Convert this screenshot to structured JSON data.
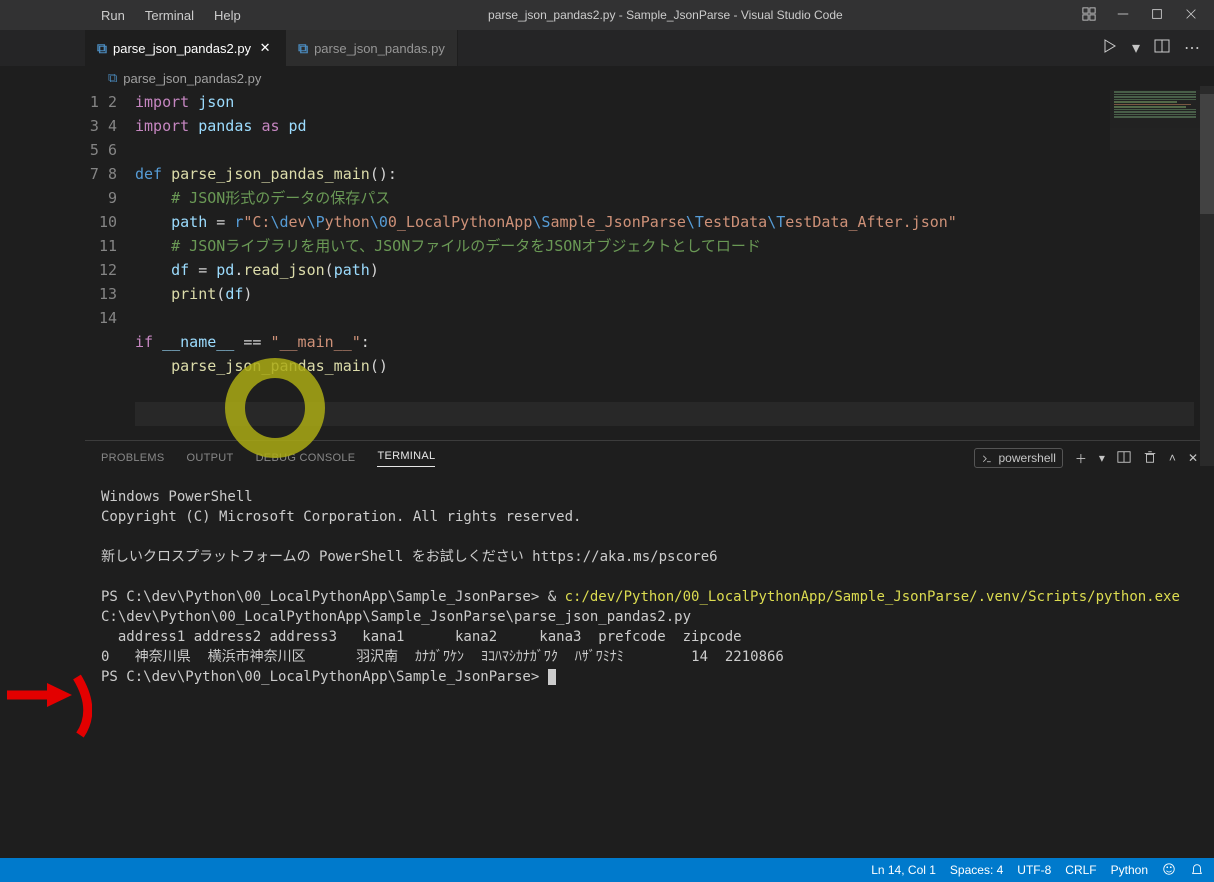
{
  "titlebar": {
    "menu": [
      "Run",
      "Terminal",
      "Help"
    ],
    "title": "parse_json_pandas2.py - Sample_JsonParse - Visual Studio Code"
  },
  "tabs": [
    {
      "icon": "python",
      "label": "parse_json_pandas2.py",
      "active": true,
      "dirty": false
    },
    {
      "icon": "python",
      "label": "parse_json_pandas.py",
      "active": false,
      "dirty": false
    }
  ],
  "breadcrumb": {
    "icon": "python",
    "file": "parse_json_pandas2.py"
  },
  "code": {
    "lines": [
      {
        "n": 1,
        "html": "<span class='kw'>import</span> <span class='var'>json</span>"
      },
      {
        "n": 2,
        "html": "<span class='kw'>import</span> <span class='var'>pandas</span> <span class='kw'>as</span> <span class='var'>pd</span>"
      },
      {
        "n": 3,
        "html": ""
      },
      {
        "n": 4,
        "html": "<span class='kw2'>def</span> <span class='fn'>parse_json_pandas_main</span><span class='op'>():</span>"
      },
      {
        "n": 5,
        "html": "    <span class='cmt'># JSON形式のデータの保存パス</span>"
      },
      {
        "n": 6,
        "html": "    <span class='var'>path</span> <span class='op'>=</span> <span class='kw2'>r</span><span class='str'>\"C:<span class='kw2'>\\d</span>ev<span class='kw2'>\\P</span>ython<span class='kw2'>\\0</span>0_LocalPythonApp<span class='kw2'>\\S</span>ample_JsonParse<span class='kw2'>\\T</span>estData<span class='kw2'>\\T</span>estData_After.json\"</span>"
      },
      {
        "n": 7,
        "html": "    <span class='cmt'># JSONライブラリを用いて、JSONファイルのデータをJSONオブジェクトとしてロード</span>"
      },
      {
        "n": 8,
        "html": "    <span class='var'>df</span> <span class='op'>=</span> <span class='var'>pd</span><span class='op'>.</span><span class='fn'>read_json</span><span class='op'>(</span><span class='var'>path</span><span class='op'>)</span>"
      },
      {
        "n": 9,
        "html": "    <span class='fn'>print</span><span class='op'>(</span><span class='var'>df</span><span class='op'>)</span>"
      },
      {
        "n": 10,
        "html": ""
      },
      {
        "n": 11,
        "html": "<span class='kw'>if</span> <span class='var'>__name__</span> <span class='op'>==</span> <span class='str'>\"__main__\"</span><span class='op'>:</span>"
      },
      {
        "n": 12,
        "html": "    <span class='fn'>parse_json_pandas_main</span><span class='op'>()</span>"
      },
      {
        "n": 13,
        "html": ""
      },
      {
        "n": 14,
        "html": ""
      }
    ]
  },
  "panel": {
    "tabs": [
      "PROBLEMS",
      "OUTPUT",
      "DEBUG CONSOLE",
      "TERMINAL"
    ],
    "active_tab": "TERMINAL",
    "shell_name": "powershell",
    "terminal_lines": [
      {
        "t": "Windows PowerShell"
      },
      {
        "t": "Copyright (C) Microsoft Corporation. All rights reserved."
      },
      {
        "t": ""
      },
      {
        "t": "新しいクロスプラットフォームの PowerShell をお試しください https://aka.ms/pscore6"
      },
      {
        "t": ""
      },
      {
        "prefix": "PS C:\\dev\\Python\\00_LocalPythonApp\\Sample_JsonParse> & ",
        "yel": "c:/dev/Python/00_LocalPythonApp/Sample_JsonParse/.venv/Scripts/python.exe",
        "rest": " C:\\dev\\Python\\00_LocalPythonApp\\Sample_JsonParse\\parse_json_pandas2.py"
      },
      {
        "t": "  address1 address2 address3   kana1      kana2     kana3  prefcode  zipcode"
      },
      {
        "t": "0   神奈川県  横浜市神奈川区      羽沢南  ｶﾅｶﾞﾜｹﾝ  ﾖｺﾊﾏｼｶﾅｶﾞﾜｸ  ﾊｻﾞﾜﾐﾅﾐ        14  2210866"
      },
      {
        "prompt": "PS C:\\dev\\Python\\00_LocalPythonApp\\Sample_JsonParse> ",
        "cursor": true
      }
    ]
  },
  "status": {
    "ln_col": "Ln 14, Col 1",
    "spaces": "Spaces: 4",
    "encoding": "UTF-8",
    "eol": "CRLF",
    "lang": "Python"
  }
}
